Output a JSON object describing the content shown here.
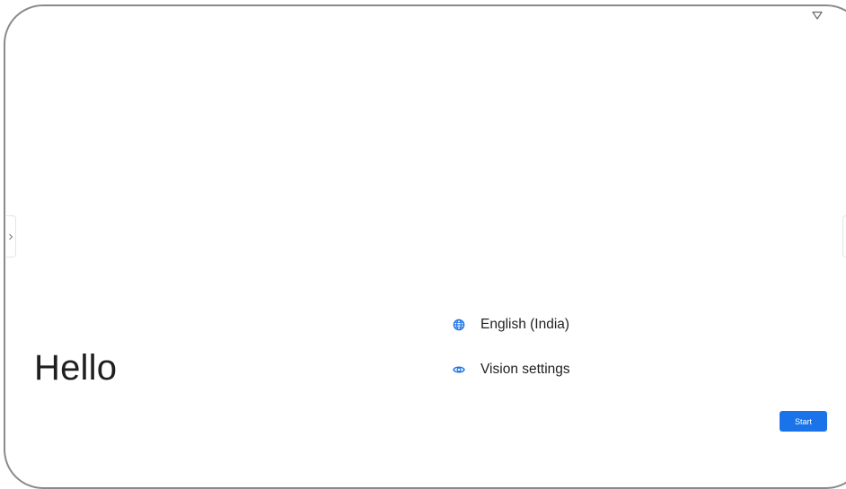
{
  "colors": {
    "accent": "#1a73e8",
    "text": "#1f1f1f",
    "frame": "#8a8a8a"
  },
  "status_bar": {
    "icons": [
      "wifi-icon"
    ]
  },
  "welcome": {
    "title": "Hello"
  },
  "options": {
    "language": {
      "icon": "globe-icon",
      "label": "English (India)"
    },
    "vision": {
      "icon": "eye-icon",
      "label": "Vision settings"
    }
  },
  "actions": {
    "start_label": "Start"
  },
  "edge_handles": {
    "left_icon": "chevron-right-icon"
  }
}
